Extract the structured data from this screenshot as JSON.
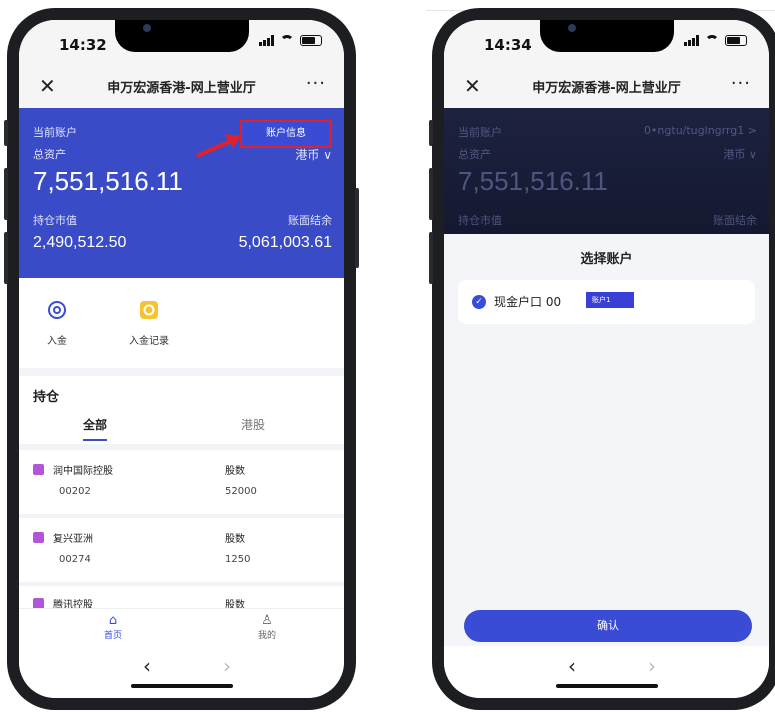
{
  "left": {
    "status": {
      "time": "14:32"
    },
    "nav": {
      "close": "✕",
      "title": "申万宏源香港-网上营业厅",
      "more": "···"
    },
    "account": {
      "current_label": "当前账户",
      "info_button": "账户信息",
      "total_assets_label": "总资产",
      "currency": "港币 ∨",
      "total_assets": "7,551,516.11",
      "market_value_label": "持仓市值",
      "balance_label": "账面结余",
      "market_value": "2,490,512.50",
      "balance": "5,061,003.61"
    },
    "quick": {
      "deposit": "入金",
      "deposit_records": "入金记录"
    },
    "holdings": {
      "title": "持仓",
      "tabs": [
        "全部",
        "港股"
      ],
      "rows": [
        {
          "name": "润中国际控股",
          "code": "00202",
          "qty_label": "股数",
          "qty": "52000"
        },
        {
          "name": "复兴亚洲",
          "code": "00274",
          "qty_label": "股数",
          "qty": "1250"
        },
        {
          "name": "腾讯控股",
          "code": "",
          "qty_label": "股数",
          "qty": ""
        }
      ]
    },
    "tabbar": {
      "home": "首页",
      "mine": "我的"
    },
    "browser": {
      "back": "‹",
      "forward": "›"
    }
  },
  "right": {
    "status": {
      "time": "14:34"
    },
    "nav": {
      "close": "✕",
      "title": "申万宏源香港-网上营业厅",
      "more": "···"
    },
    "dim": {
      "current_label": "当前账户",
      "account_text": "0•ngtu/tuglngrrg1 >",
      "total_assets_label": "总资产",
      "currency": "港币 ∨",
      "total_assets": "7,551,516.11",
      "market_value_label": "持仓市值",
      "balance_label": "账面结余"
    },
    "sheet": {
      "title": "选择账户",
      "option_text": "现金户口 00",
      "option_tag": "账户1",
      "confirm": "确认"
    },
    "browser": {
      "back": "‹",
      "forward": "›"
    }
  },
  "colors": {
    "accent": "#3a4bd6",
    "card": "#3a4bc8",
    "highlight": "#e0202a",
    "badge": "#b256d9"
  }
}
